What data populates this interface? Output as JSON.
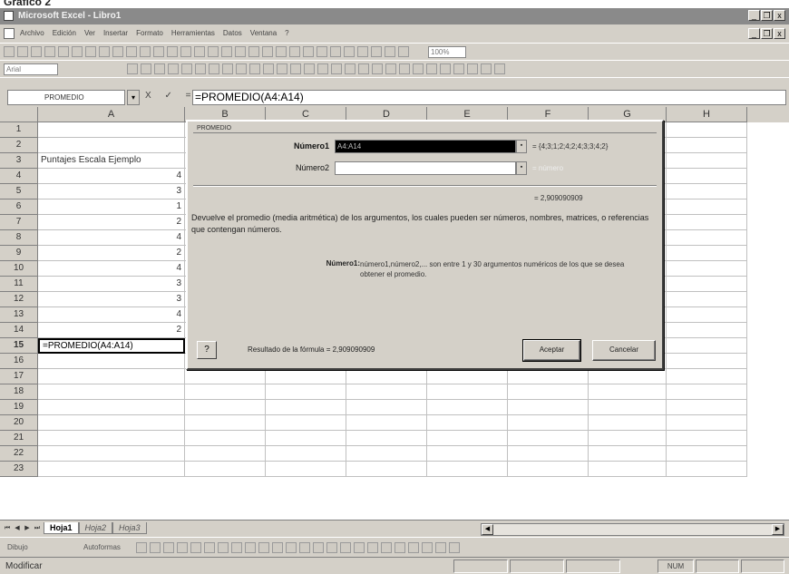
{
  "header_caption": "Gráfico 2",
  "window": {
    "title": "Microsoft Excel - Libro1",
    "min_glyph": "_",
    "restore_glyph": "❐",
    "close_glyph": "x"
  },
  "menu": [
    "Archivo",
    "Edición",
    "Ver",
    "Insertar",
    "Formato",
    "Herramientas",
    "Datos",
    "Ventana",
    "?"
  ],
  "toolbar": {
    "font_name": "Arial",
    "zoom": "100%"
  },
  "formula_bar": {
    "name_box": "PROMEDIO",
    "name_box_arrow": "▾",
    "buttons": "X ✓ =",
    "formula": "=PROMEDIO(A4:A14)"
  },
  "columns": [
    "A",
    "B",
    "C",
    "D",
    "E",
    "F",
    "G",
    "H"
  ],
  "rows": [
    {
      "n": "1",
      "a": ""
    },
    {
      "n": "2",
      "a": ""
    },
    {
      "n": "3",
      "a": "Puntajes Escala Ejemplo"
    },
    {
      "n": "4",
      "a": "4"
    },
    {
      "n": "5",
      "a": "3"
    },
    {
      "n": "6",
      "a": "1"
    },
    {
      "n": "7",
      "a": "2"
    },
    {
      "n": "8",
      "a": "4"
    },
    {
      "n": "9",
      "a": "2"
    },
    {
      "n": "10",
      "a": "4"
    },
    {
      "n": "11",
      "a": "3"
    },
    {
      "n": "12",
      "a": "3"
    },
    {
      "n": "13",
      "a": "4"
    },
    {
      "n": "14",
      "a": "2"
    },
    {
      "n": "15",
      "a": "=PROMEDIO(A4:A14)"
    },
    {
      "n": "16",
      "a": ""
    },
    {
      "n": "17",
      "a": ""
    },
    {
      "n": "18",
      "a": ""
    },
    {
      "n": "19",
      "a": ""
    },
    {
      "n": "20",
      "a": ""
    },
    {
      "n": "21",
      "a": ""
    },
    {
      "n": "22",
      "a": ""
    },
    {
      "n": "23",
      "a": ""
    }
  ],
  "dialog": {
    "title": "PROMEDIO",
    "arg1_label": "Número1",
    "arg1_value": "A4:A14",
    "arg1_result": "= {4;3;1;2;4;2;4;3;3;4;2}",
    "arg2_label": "Número2",
    "arg2_value": "",
    "arg2_result": "= número",
    "collapse_glyph": "▪",
    "result": "= 2,909090909",
    "description": "Devuelve el promedio (media aritmética) de los argumentos, los cuales pueden ser números, nombres, matrices, o referencias que contengan números.",
    "help_term": "Número1:",
    "help_text": "número1,número2,... son entre 1 y 30 argumentos numéricos de los que se desea obtener el promedio.",
    "help_button": "?",
    "formula_result": "Resultado de la fórmula = 2,909090909",
    "ok_label": "Aceptar",
    "cancel_label": "Cancelar"
  },
  "sheet_tabs": {
    "nav": [
      "⏮",
      "◀",
      "▶",
      "⏭"
    ],
    "tabs": [
      "Hoja1",
      "Hoja2",
      "Hoja3"
    ],
    "scroll_left": "◀",
    "scroll_right": "▶"
  },
  "draw_toolbar": {
    "dibujo": "Dibujo",
    "autoformas": "Autoformas"
  },
  "status": {
    "mode": "Modificar",
    "num": "NUM"
  }
}
